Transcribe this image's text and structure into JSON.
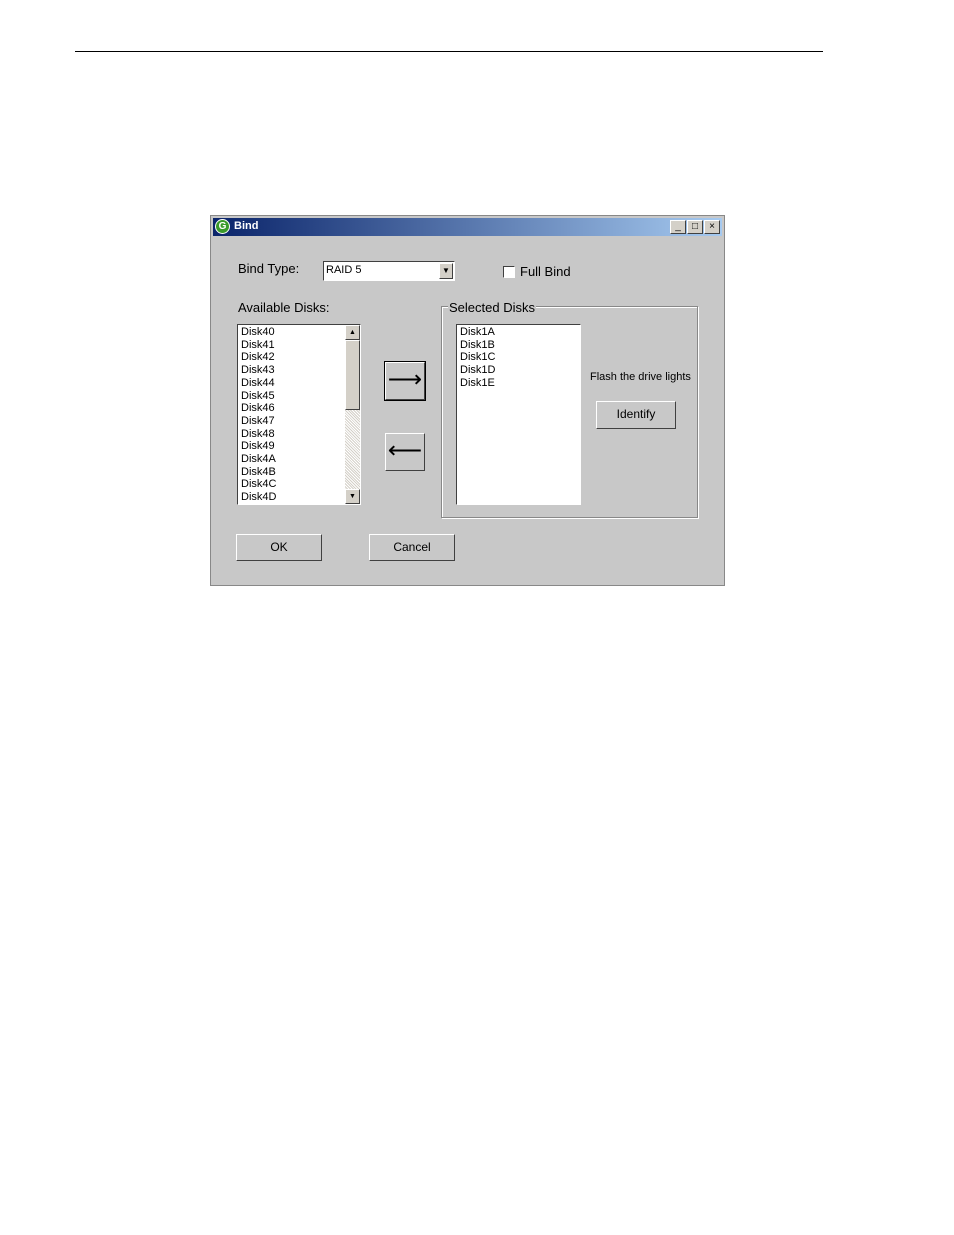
{
  "window": {
    "title": "Bind",
    "app_icon": "G",
    "controls": {
      "minimize": "_",
      "maximize": "□",
      "close": "×"
    }
  },
  "bind_type": {
    "label": "Bind Type:",
    "value": "RAID 5",
    "arrow": "▼"
  },
  "full_bind": {
    "label": "Full Bind",
    "checked": false
  },
  "available_disks": {
    "label": "Available Disks:",
    "items": [
      "Disk40",
      "Disk41",
      "Disk42",
      "Disk43",
      "Disk44",
      "Disk45",
      "Disk46",
      "Disk47",
      "Disk48",
      "Disk49",
      "Disk4A",
      "Disk4B",
      "Disk4C",
      "Disk4D"
    ],
    "scroll_up": "▲",
    "scroll_down": "▼"
  },
  "move_buttons": {
    "right": "⟶",
    "left": "⟵"
  },
  "selected_disks": {
    "label": "Selected Disks",
    "items": [
      "Disk1A",
      "Disk1B",
      "Disk1C",
      "Disk1D",
      "Disk1E"
    ]
  },
  "identify": {
    "hint": "Flash the drive lights",
    "button": "Identify"
  },
  "footer": {
    "ok": "OK",
    "cancel": "Cancel"
  }
}
